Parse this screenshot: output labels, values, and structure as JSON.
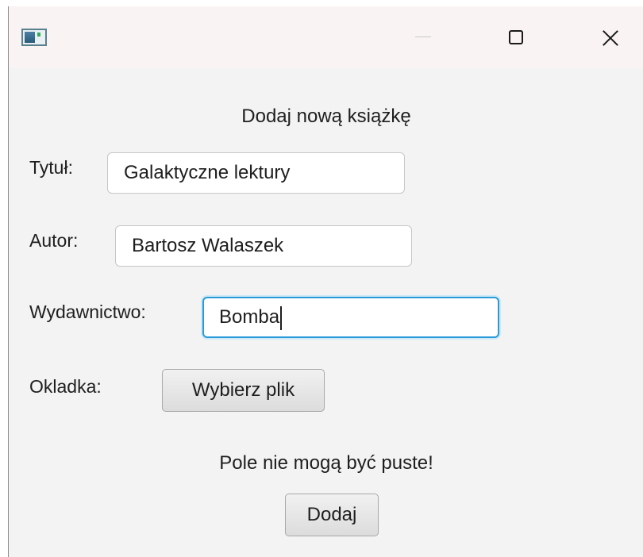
{
  "window": {
    "app_icon": "java-window-icon",
    "controls": {
      "minimize_icon": "minimize-icon",
      "maximize_icon": "maximize-icon",
      "close_icon": "close-icon"
    }
  },
  "form": {
    "heading": "Dodaj nową książkę",
    "title_label": "Tytuł:",
    "title_value": "Galaktyczne lektury",
    "author_label": "Autor:",
    "author_value": "Bartosz Walaszek",
    "publisher_label": "Wydawnictwo:",
    "publisher_value": "Bomba",
    "cover_label": "Okladka:",
    "choose_file_label": "Wybierz plik",
    "error_message": "Pole nie mogą być puste!",
    "submit_label": "Dodaj"
  },
  "colors": {
    "window_background": "#f3f3f3",
    "titlebar_background": "#f9f3f3",
    "focus_accent": "#2a9bd8",
    "text": "#1e1e1e"
  }
}
